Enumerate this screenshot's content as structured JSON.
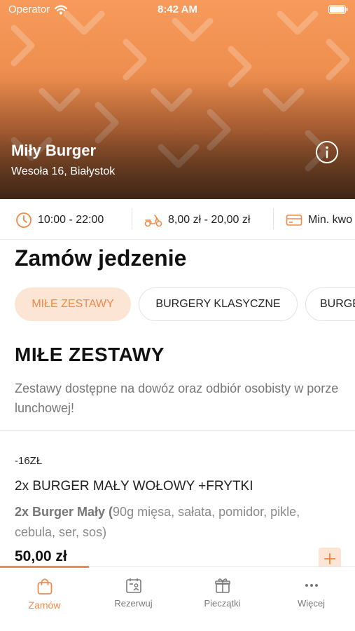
{
  "status_bar": {
    "carrier": "Operator",
    "time": "8:42 AM"
  },
  "restaurant": {
    "name": "Miły Burger",
    "address": "Wesoła 16, Białystok"
  },
  "info": {
    "hours": "10:00 - 22:00",
    "delivery": "8,00 zł - 20,00 zł",
    "min_order": "Min. kwo"
  },
  "page_title": "Zamów jedzenie",
  "categories": [
    {
      "label": "MIŁE ZESTAWY",
      "active": true
    },
    {
      "label": "BURGERY KLASYCZNE",
      "active": false
    },
    {
      "label": "BURGE",
      "active": false
    }
  ],
  "section": {
    "title": "MIŁE ZESTAWY",
    "description": "Zestawy dostępne na dowóz oraz odbiór osobisty w porze lunchowej!"
  },
  "product": {
    "tag": "-16ZŁ",
    "name": "2x BURGER MAŁY WOŁOWY +FRYTKI",
    "desc_bold": "2x Burger Mały (",
    "desc_rest": "90g mięsa, sałata, pomidor, pikle, cebula, ser, sos)",
    "price": "50,00 zł"
  },
  "tabs": [
    {
      "label": "Zamów",
      "icon": "bag-icon",
      "active": true
    },
    {
      "label": "Rezerwuj",
      "icon": "calendar-person-icon",
      "active": false
    },
    {
      "label": "Pieczątki",
      "icon": "gift-icon",
      "active": false
    },
    {
      "label": "Więcej",
      "icon": "more-dots-icon",
      "active": false
    }
  ],
  "colors": {
    "accent": "#f08a4a",
    "accent_light": "#fde5d6",
    "text": "#111111",
    "muted": "#777777"
  }
}
